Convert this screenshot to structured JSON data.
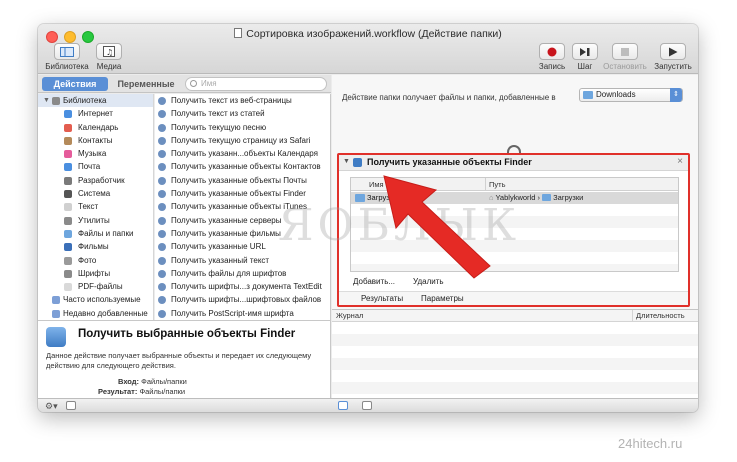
{
  "window": {
    "title": "Сортировка изображений.workflow (Действие папки)"
  },
  "toolbar": {
    "left": [
      {
        "label": "Библиотека",
        "icon": "library-icon"
      },
      {
        "label": "Медиа",
        "icon": "media-icon"
      }
    ],
    "right": [
      {
        "label": "Запись",
        "icon": "record-icon",
        "enabled": true
      },
      {
        "label": "Шаг",
        "icon": "step-icon",
        "enabled": true
      },
      {
        "label": "Остановить",
        "icon": "stop-icon",
        "enabled": false
      },
      {
        "label": "Запустить",
        "icon": "play-icon",
        "enabled": true
      }
    ]
  },
  "tabs": {
    "actions": "Действия",
    "variables": "Переменные"
  },
  "search": {
    "placeholder": "Имя"
  },
  "library": {
    "root": "Библиотека",
    "items": [
      {
        "label": "Интернет",
        "color": "#4a8fe0"
      },
      {
        "label": "Календарь",
        "color": "#e35d4f"
      },
      {
        "label": "Контакты",
        "color": "#b48a5a"
      },
      {
        "label": "Музыка",
        "color": "#e55c9b"
      },
      {
        "label": "Почта",
        "color": "#4a8fe0"
      },
      {
        "label": "Разработчик",
        "color": "#7a7a7a"
      },
      {
        "label": "Система",
        "color": "#555555"
      },
      {
        "label": "Текст",
        "color": "#d0d0d0"
      },
      {
        "label": "Утилиты",
        "color": "#8a8a8a"
      },
      {
        "label": "Файлы и папки",
        "color": "#6ea6de"
      },
      {
        "label": "Фильмы",
        "color": "#3b6fb8"
      },
      {
        "label": "Фото",
        "color": "#9a9a9a"
      },
      {
        "label": "Шрифты",
        "color": "#8a8a8a"
      },
      {
        "label": "PDF-файлы",
        "color": "#d9d9d9"
      }
    ],
    "bottom": [
      {
        "label": "Часто используемые",
        "color": "#7d9fd6"
      },
      {
        "label": "Недавно добавленные",
        "color": "#7d9fd6"
      }
    ]
  },
  "actions": [
    "Получить текст из веб-страницы",
    "Получить текст из статей",
    "Получить текущую песню",
    "Получить текущую страницу из Safari",
    "Получить указанн...объекты Календаря",
    "Получить указанные объекты Контактов",
    "Получить указанные объекты Почты",
    "Получить указанные объекты Finder",
    "Получить указанные объекты iTunes",
    "Получить указанные серверы",
    "Получить указанные фильмы",
    "Получить указанные URL",
    "Получить указанный текст",
    "Получить файлы для шрифтов",
    "Получить шрифты...з документа TextEdit",
    "Получить шрифты...шрифтовых файлов",
    "Получить PostScript-имя шрифта"
  ],
  "description": {
    "title": "Получить выбранные объекты Finder",
    "text": "Данное действие получает выбранные объекты и передает их следующему действию для следующего действия.",
    "input_label": "Вход:",
    "input_value": "Файлы/папки",
    "result_label": "Результат:",
    "result_value": "Файлы/папки"
  },
  "folder_action": {
    "label": "Действие папки получает файлы и папки, добавленные в",
    "folder": "Downloads"
  },
  "action_box": {
    "title": "Получить указанные объекты Finder",
    "columns": {
      "name": "Имя",
      "path": "Путь"
    },
    "row": {
      "name": "Загрузки",
      "path_user": "Yablykworld",
      "path_sep": "›",
      "path_folder": "Загрузки"
    },
    "add_button": "Добавить...",
    "remove_button": "Удалить",
    "tab_results": "Результаты",
    "tab_params": "Параметры"
  },
  "log": {
    "col_journal": "Журнал",
    "col_duration": "Длительность"
  },
  "watermark": {
    "logo": "ЯОБЛЫК",
    "site": "24hitech.ru"
  },
  "colors": {
    "accent": "#5a8fd6",
    "highlight_border": "#e0302a",
    "arrow": "#e52a25"
  }
}
